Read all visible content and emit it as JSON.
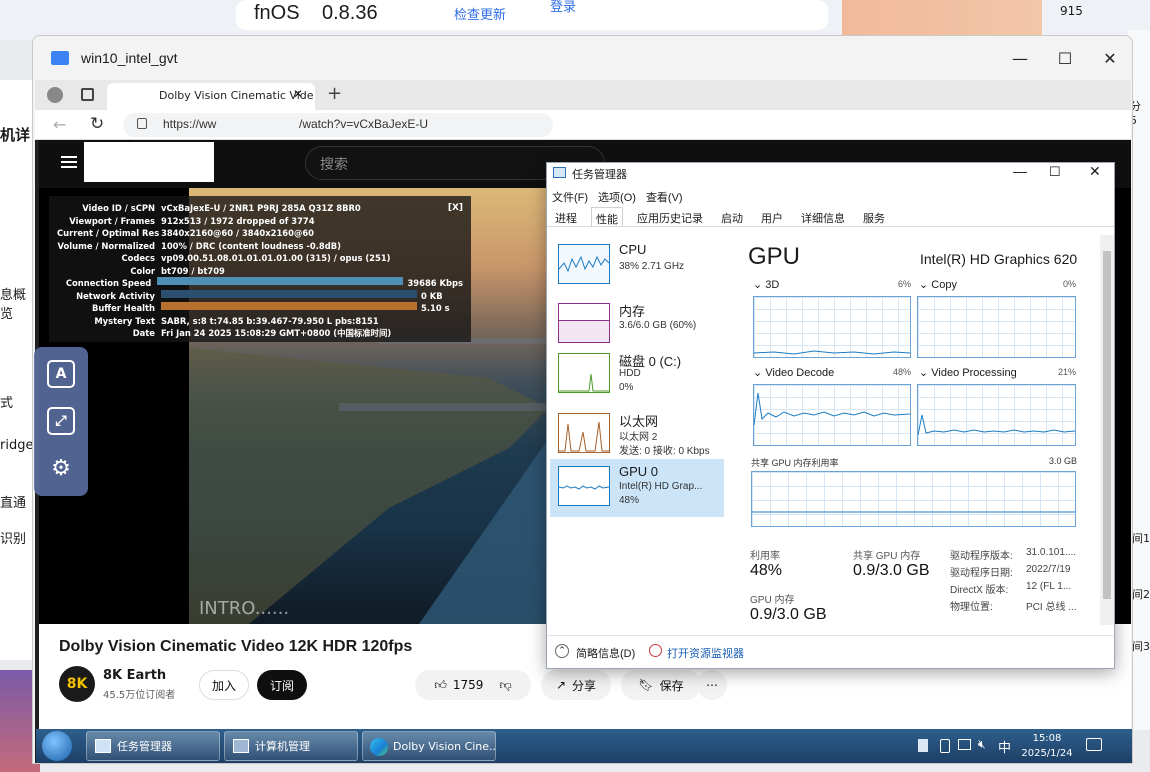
{
  "host": {
    "os_name": "fnOS",
    "os_version": "0.8.36",
    "check_update": "检查更新",
    "login": "登录",
    "top_num": "915",
    "left_labels": [
      "机详",
      "息概览",
      "式",
      "ridge",
      "直通",
      "识别"
    ],
    "right_labels": [
      "分 5",
      "间1",
      "间2",
      "间3"
    ]
  },
  "vm": {
    "title": "win10_intel_gvt",
    "minimize": "—",
    "maximize": "☐",
    "close": "✕"
  },
  "edge": {
    "tab_title": "Dolby Vision Cinematic Vide",
    "tab_close": "✕",
    "new_tab": "+",
    "url_left": "https://ww",
    "url_right": "/watch?v=vCxBaJexE-U"
  },
  "youtube": {
    "search_placeholder": "搜索",
    "stats": [
      {
        "k": "Video ID / sCPN",
        "v": "vCxBaJexE-U / 2NR1 P9RJ 285A Q31Z 8BR0"
      },
      {
        "k": "Viewport / Frames",
        "v": "912x513 / 1972 dropped of 3774"
      },
      {
        "k": "Current / Optimal Res",
        "v": "3840x2160@60 / 3840x2160@60"
      },
      {
        "k": "Volume / Normalized",
        "v": "100% / DRC (content loudness -0.8dB)"
      },
      {
        "k": "Codecs",
        "v": "vp09.00.51.08.01.01.01.01.00 (315) / opus (251)"
      },
      {
        "k": "Color",
        "v": "bt709 / bt709"
      },
      {
        "k": "Connection Speed",
        "v": "39686 Kbps"
      },
      {
        "k": "Network Activity",
        "v": "0 KB"
      },
      {
        "k": "Buffer Health",
        "v": "5.10 s"
      },
      {
        "k": "Mystery Text",
        "v": "SABR, s:8 t:74.85 b:39.467-79.950 L pbs:8151"
      },
      {
        "k": "Date",
        "v": "Fri Jan 24 2025 15:08:29 GMT+0800 (中国标准时间)"
      }
    ],
    "stats_close": "[X]",
    "intro": "INTRO......",
    "video_title": "Dolby Vision Cinematic Video 12K HDR 120fps",
    "channel": "8K Earth",
    "subscribers": "45.5万位订阅者",
    "join": "加入",
    "subscribe": "订阅",
    "likes": "1759",
    "share": "分享",
    "save": "保存",
    "more": "⋯"
  },
  "taskmgr": {
    "title": "任务管理器",
    "menu": [
      "文件(F)",
      "选项(O)",
      "查看(V)"
    ],
    "tabs": [
      "进程",
      "性能",
      "应用历史记录",
      "启动",
      "用户",
      "详细信息",
      "服务"
    ],
    "sidebar": [
      {
        "name": "CPU",
        "sub1": "38% 2.71 GHz",
        "sub2": ""
      },
      {
        "name": "内存",
        "sub1": "3.6/6.0 GB (60%)",
        "sub2": ""
      },
      {
        "name": "磁盘 0 (C:)",
        "sub1": "HDD",
        "sub2": "0%"
      },
      {
        "name": "以太网",
        "sub1": "以太网 2",
        "sub2": "发送: 0 接收: 0 Kbps"
      },
      {
        "name": "GPU 0",
        "sub1": "Intel(R) HD Grap...",
        "sub2": "48%"
      }
    ],
    "gpu_heading": "GPU",
    "gpu_model": "Intel(R) HD Graphics 620",
    "engines": [
      {
        "name": "3D",
        "pct": "6%"
      },
      {
        "name": "Copy",
        "pct": "0%"
      },
      {
        "name": "Video Decode",
        "pct": "48%"
      },
      {
        "name": "Video Processing",
        "pct": "21%"
      }
    ],
    "shared_label": "共享 GPU 内存利用率",
    "shared_max": "3.0 GB",
    "util_label": "利用率",
    "util_value": "48%",
    "shared_mem_label": "共享 GPU 内存",
    "shared_mem_value": "0.9/3.0 GB",
    "gpu_mem_label": "GPU 内存",
    "gpu_mem_value": "0.9/3.0 GB",
    "info": [
      {
        "k": "驱动程序版本:",
        "v": "31.0.101...."
      },
      {
        "k": "驱动程序日期:",
        "v": "2022/7/19"
      },
      {
        "k": "DirectX 版本:",
        "v": "12 (FL 1..."
      },
      {
        "k": "物理位置:",
        "v": "PCI 总线 ..."
      }
    ],
    "fewer_details": "简略信息(D)",
    "open_monitor": "打开资源监视器"
  },
  "taskbar": {
    "items": [
      "任务管理器",
      "计算机管理",
      "Dolby Vision Cine..."
    ],
    "ime": "中",
    "time": "15:08",
    "date": "2025/1/24"
  }
}
